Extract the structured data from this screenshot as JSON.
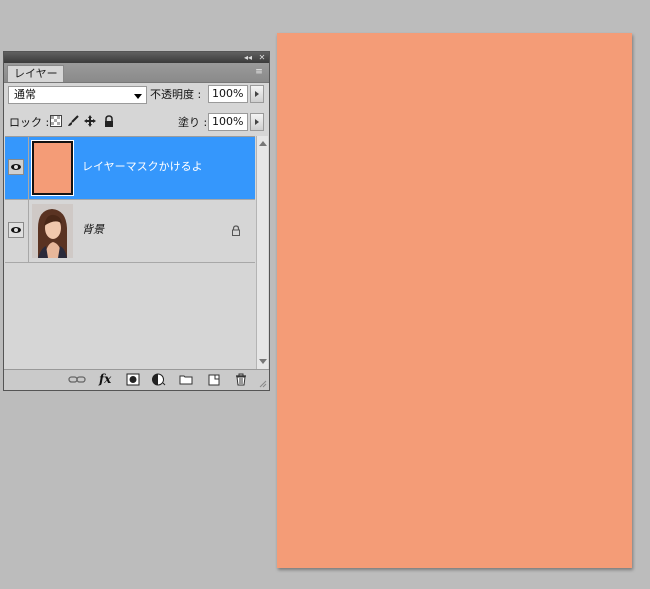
{
  "canvas": {
    "color": "#f49c77"
  },
  "panel": {
    "title_buttons": {
      "collapse": "◂◂",
      "close": "✕"
    },
    "tab_label": "レイヤー",
    "menu_icon": "≡",
    "blend_mode": "通常",
    "opacity_label": "不透明度 :",
    "opacity_value": "100%",
    "lock_label": "ロック :",
    "fill_label": "塗り :",
    "fill_value": "100%",
    "lock_icons": [
      "lock-transparent-icon",
      "lock-pixels-icon",
      "lock-position-icon",
      "lock-all-icon"
    ],
    "layers": [
      {
        "name": "レイヤーマスクかけるよ",
        "selected": true,
        "visible": true,
        "thumb_color": "#f49c77"
      },
      {
        "name": "背景",
        "selected": false,
        "visible": true,
        "locked": true
      }
    ],
    "bottom_icons": [
      "link-layers-icon",
      "fx-icon",
      "add-mask-icon",
      "adjustment-layer-icon",
      "new-group-icon",
      "new-layer-icon",
      "trash-icon"
    ],
    "fx_label": "fx",
    "accent": "#3597fc"
  }
}
